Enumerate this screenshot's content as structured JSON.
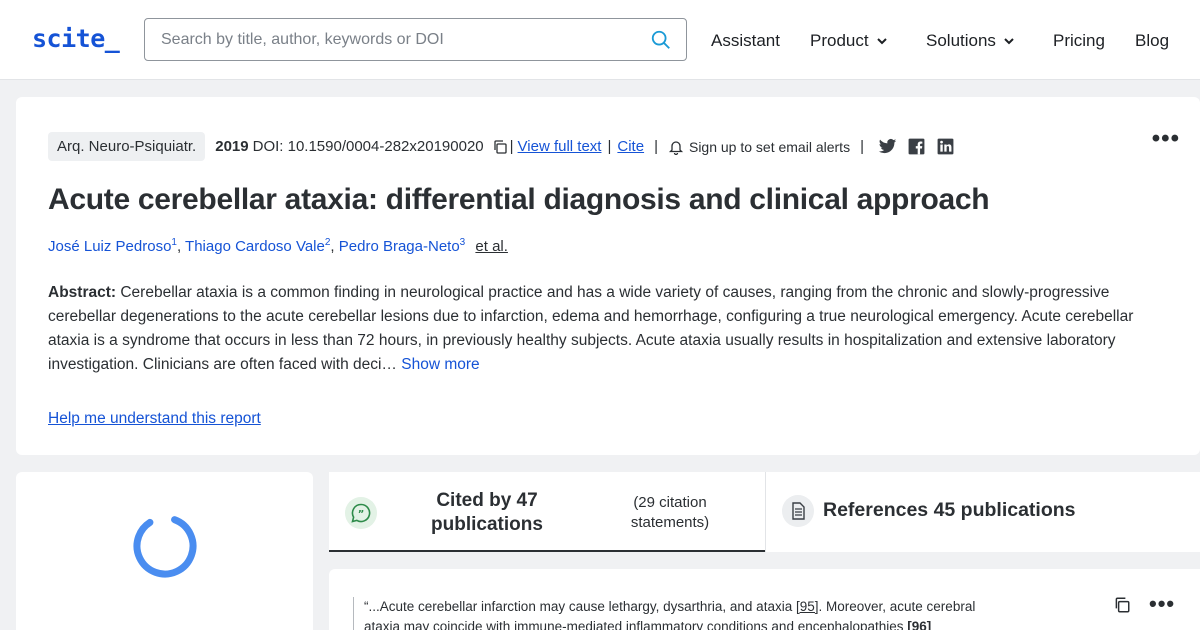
{
  "header": {
    "logo": "scite_",
    "search_placeholder": "Search by title, author, keywords or DOI",
    "nav": {
      "assistant": "Assistant",
      "product": "Product",
      "solutions": "Solutions",
      "pricing": "Pricing",
      "blog": "Blog"
    }
  },
  "paper": {
    "journal": "Arq. Neuro-Psiquiatr.",
    "year": "2019",
    "doi": "DOI: 10.1590/0004-282x20190020",
    "pipe": "|",
    "view_full_text": "View full text",
    "cite": "Cite",
    "email_alerts": "Sign up to set email alerts",
    "more": "•••",
    "title": "Acute cerebellar ataxia: differential diagnosis and clinical approach",
    "authors": [
      {
        "name": "José Luiz Pedroso",
        "sup": "1"
      },
      {
        "name": "Thiago Cardoso Vale",
        "sup": "2"
      },
      {
        "name": "Pedro Braga-Neto",
        "sup": "3"
      }
    ],
    "author_separator": ",",
    "et_al": "et al.",
    "abstract_label": "Abstract:",
    "abstract_text": "Cerebellar ataxia is a common finding in neurological practice and has a wide variety of causes, ranging from the chronic and slowly-progressive cerebellar degenerations to the acute cerebellar lesions due to infarction, edema and hemorrhage, configuring a true neurological emergency. Acute cerebellar ataxia is a syndrome that occurs in less than 72 hours, in previously healthy subjects. Acute ataxia usually results in hospitalization and extensive laboratory investigation. Clinicians are often faced with deci…",
    "show_more": "Show more",
    "help_link": "Help me understand this report"
  },
  "tabs": {
    "cited_main": "Cited by 47 publications",
    "cited_sub": "(29 citation statements)",
    "references": "References 45 publications"
  },
  "citation": {
    "part1": "“...Acute cerebellar infarction may cause lethargy, dysarthria, and ataxia ",
    "ref1": "[95]",
    "part2": ". Moreover, acute cerebral ataxia may coincide with immune-mediated inflammatory conditions and encephalopathies ",
    "ref2": "[96]",
    "more": "•••"
  },
  "colors": {
    "brand": "#1553d6",
    "link": "#1553d6",
    "spinner": "#3b82f6",
    "quote_icon": "#2e8b4a"
  },
  "icons": {
    "search": "magnifier-icon",
    "copy": "copy-icon",
    "bell": "bell-icon",
    "twitter": "twitter-icon",
    "facebook": "facebook-icon",
    "linkedin": "linkedin-icon",
    "quote": "quote-bubble-icon",
    "document": "document-icon"
  }
}
